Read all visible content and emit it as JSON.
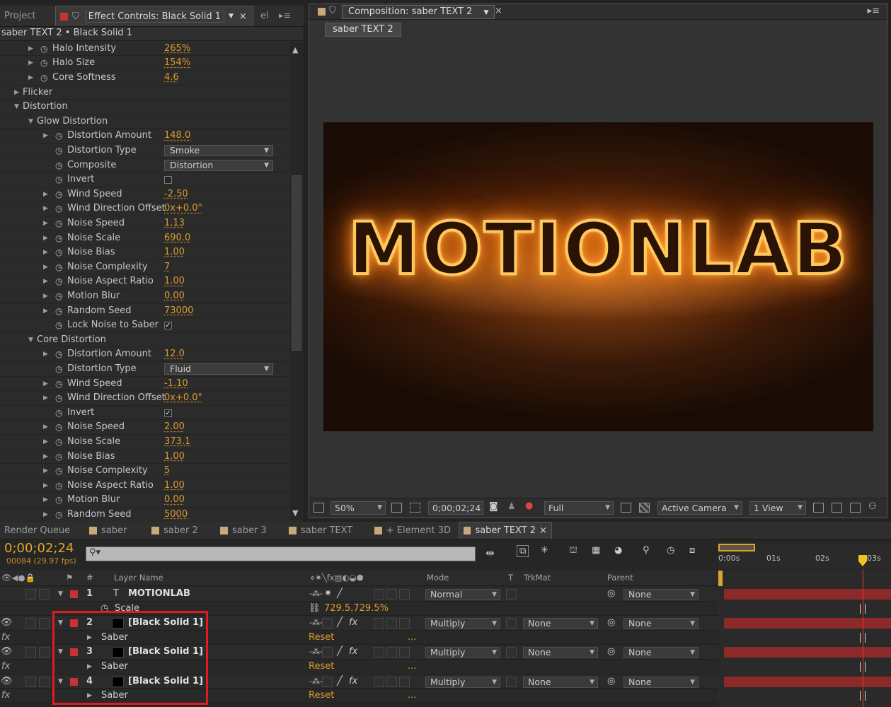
{
  "project_tab": "Project",
  "effect_controls_tab": "Effect Controls: Black Solid 1",
  "extra_tab": "el",
  "effect_header": "saber TEXT 2 • Black Solid 1",
  "params": [
    {
      "name": "Halo Intensity",
      "value": "265%",
      "kind": "num",
      "indent": 2,
      "twirl": true
    },
    {
      "name": "Halo Size",
      "value": "154%",
      "kind": "num",
      "indent": 2,
      "twirl": true
    },
    {
      "name": "Core Softness",
      "value": "4.6",
      "kind": "num",
      "indent": 2,
      "twirl": true
    },
    {
      "name": "Flicker",
      "kind": "group",
      "indent": 0,
      "open": false
    },
    {
      "name": "Distortion",
      "kind": "group",
      "indent": 0,
      "open": true
    },
    {
      "name": "Glow Distortion",
      "kind": "group",
      "indent": 1,
      "open": true
    },
    {
      "name": "Distortion Amount",
      "value": "148.0",
      "kind": "num",
      "indent": 3,
      "twirl": true
    },
    {
      "name": "Distortion Type",
      "value": "Smoke",
      "kind": "dropdown",
      "indent": 3,
      "twirl": false
    },
    {
      "name": "Composite",
      "value": "Distortion",
      "kind": "dropdown",
      "indent": 3,
      "twirl": false
    },
    {
      "name": "Invert",
      "value": "",
      "kind": "checkbox",
      "indent": 3,
      "twirl": false
    },
    {
      "name": "Wind Speed",
      "value": "-2.50",
      "kind": "num",
      "indent": 3,
      "twirl": true
    },
    {
      "name": "Wind Direction Offset",
      "value": "0x+0.0°",
      "kind": "num",
      "indent": 3,
      "twirl": true
    },
    {
      "name": "Noise Speed",
      "value": "1.13",
      "kind": "num",
      "indent": 3,
      "twirl": true
    },
    {
      "name": "Noise Scale",
      "value": "690.0",
      "kind": "num",
      "indent": 3,
      "twirl": true
    },
    {
      "name": "Noise Bias",
      "value": "1.00",
      "kind": "num",
      "indent": 3,
      "twirl": true
    },
    {
      "name": "Noise Complexity",
      "value": "7",
      "kind": "num",
      "indent": 3,
      "twirl": true
    },
    {
      "name": "Noise Aspect Ratio",
      "value": "1.00",
      "kind": "num",
      "indent": 3,
      "twirl": true
    },
    {
      "name": "Motion Blur",
      "value": "0.00",
      "kind": "num",
      "indent": 3,
      "twirl": true
    },
    {
      "name": "Random Seed",
      "value": "73000",
      "kind": "num",
      "indent": 3,
      "twirl": true
    },
    {
      "name": "Lock Noise to Saber",
      "value": "✓",
      "kind": "checkbox",
      "indent": 3,
      "twirl": false
    },
    {
      "name": "Core Distortion",
      "kind": "group",
      "indent": 1,
      "open": true
    },
    {
      "name": "Distortion Amount",
      "value": "12.0",
      "kind": "num",
      "indent": 3,
      "twirl": true
    },
    {
      "name": "Distortion Type",
      "value": "Fluid",
      "kind": "dropdown",
      "indent": 3,
      "twirl": false
    },
    {
      "name": "Wind Speed",
      "value": "-1.10",
      "kind": "num",
      "indent": 3,
      "twirl": true
    },
    {
      "name": "Wind Direction Offset",
      "value": "0x+0.0°",
      "kind": "num",
      "indent": 3,
      "twirl": true
    },
    {
      "name": "Invert",
      "value": "✓",
      "kind": "checkbox",
      "indent": 3,
      "twirl": false
    },
    {
      "name": "Noise Speed",
      "value": "2.00",
      "kind": "num",
      "indent": 3,
      "twirl": true
    },
    {
      "name": "Noise Scale",
      "value": "373.1",
      "kind": "num",
      "indent": 3,
      "twirl": true
    },
    {
      "name": "Noise Bias",
      "value": "1.00",
      "kind": "num",
      "indent": 3,
      "twirl": true
    },
    {
      "name": "Noise Complexity",
      "value": "5",
      "kind": "num",
      "indent": 3,
      "twirl": true
    },
    {
      "name": "Noise Aspect Ratio",
      "value": "1.00",
      "kind": "num",
      "indent": 3,
      "twirl": true
    },
    {
      "name": "Motion Blur",
      "value": "0.00",
      "kind": "num",
      "indent": 3,
      "twirl": true
    },
    {
      "name": "Random Seed",
      "value": "5000",
      "kind": "num",
      "indent": 3,
      "twirl": true
    }
  ],
  "comp": {
    "tab": "Composition: saber TEXT 2",
    "breadcrumb": "saber TEXT 2",
    "render_text": "MOTIONLAB",
    "zoom": "50%",
    "timecode": "0;00;02;24",
    "resolution": "Full",
    "camera": "Active Camera",
    "views": "1 View"
  },
  "timeline_tabs": [
    "Render Queue",
    "saber",
    "saber 2",
    "saber 3",
    "saber TEXT",
    "+ Element 3D",
    "saber TEXT 2"
  ],
  "timeline": {
    "timecode": "0;00;02;24",
    "frame_info": "00084 (29.97 fps)",
    "search_placeholder": "",
    "col_layer_name": "Layer Name",
    "col_mode": "Mode",
    "col_t": "T",
    "col_trkmat": "TrkMat",
    "col_parent": "Parent",
    "col_hash": "#",
    "ruler": [
      "0:00s",
      "01s",
      "02s",
      "03s"
    ],
    "rows": [
      {
        "type": "layer",
        "num": "1",
        "name": "MOTIONLAB",
        "mode": "Normal",
        "trkmat": "",
        "parent": "None",
        "text_layer": true
      },
      {
        "type": "sub",
        "name": "Scale",
        "value": "729.5,729.5%"
      },
      {
        "type": "layer",
        "num": "2",
        "name": "[Black Solid 1]",
        "mode": "Multiply",
        "trkmat": "None",
        "parent": "None",
        "text_layer": false
      },
      {
        "type": "sub",
        "name": "Saber",
        "value": "Reset",
        "dots": "..."
      },
      {
        "type": "layer",
        "num": "3",
        "name": "[Black Solid 1]",
        "mode": "Multiply",
        "trkmat": "None",
        "parent": "None",
        "text_layer": false
      },
      {
        "type": "sub",
        "name": "Saber",
        "value": "Reset",
        "dots": "..."
      },
      {
        "type": "layer",
        "num": "4",
        "name": "[Black Solid 1]",
        "mode": "Multiply",
        "trkmat": "None",
        "parent": "None",
        "text_layer": false
      },
      {
        "type": "sub",
        "name": "Saber",
        "value": "Reset",
        "dots": "..."
      }
    ]
  },
  "colors": {
    "value_orange": "#dc9b2c",
    "label_red": "#c83232",
    "highlight": "#e01b22",
    "bar_red": "#8c2a2a"
  }
}
